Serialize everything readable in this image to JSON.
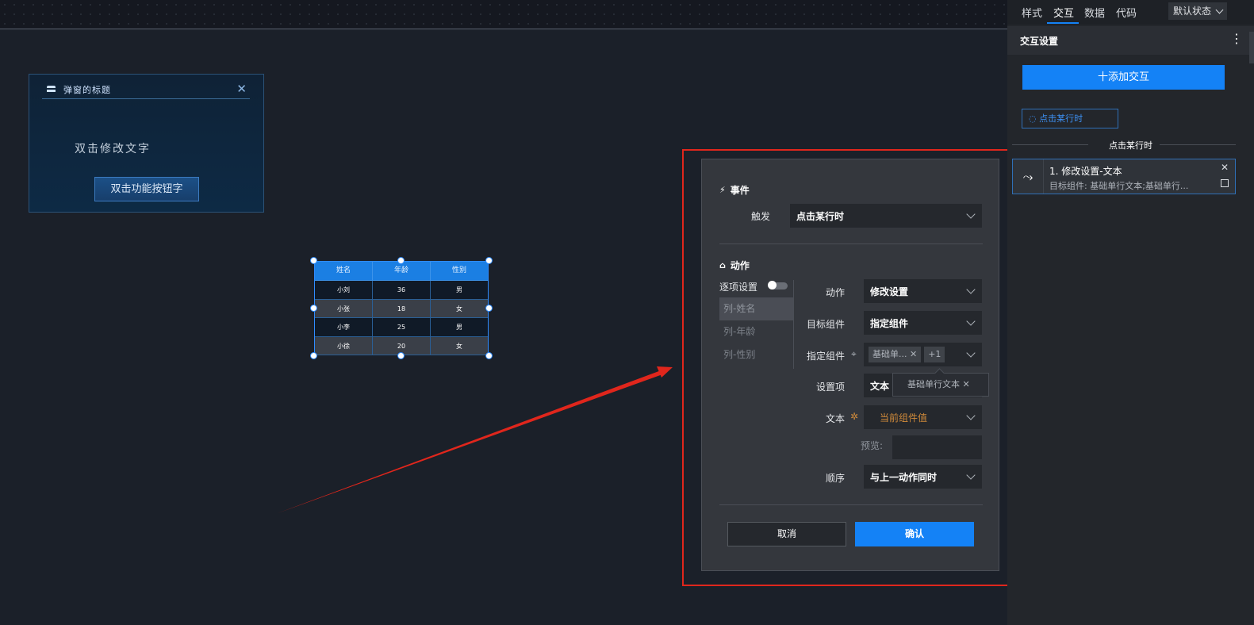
{
  "canvas": {
    "popup": {
      "title": "弹窗的标题",
      "text": "双击修改文字",
      "button": "双击功能按钮字"
    },
    "table": {
      "headers": [
        "姓名",
        "年龄",
        "性别"
      ],
      "rows": [
        [
          "小刘",
          "36",
          "男"
        ],
        [
          "小张",
          "18",
          "女"
        ],
        [
          "小李",
          "25",
          "男"
        ],
        [
          "小徐",
          "20",
          "女"
        ]
      ]
    }
  },
  "dialog": {
    "event_title": "事件",
    "trigger_label": "触发",
    "trigger_value": "点击某行时",
    "action_title": "动作",
    "itemize_label": "逐项设置",
    "side_items": [
      "列-姓名",
      "列-年龄",
      "列-性别"
    ],
    "action_label": "动作",
    "action_value": "修改设置",
    "target_label": "目标组件",
    "target_value": "指定组件",
    "specify_label": "指定组件",
    "specify_chip": "基础单...",
    "specify_more": "+1",
    "tooltip": "基础单行文本",
    "setting_label": "设置项",
    "setting_value": "文本",
    "text_label": "文本",
    "text_value": "当前组件值",
    "preview_label": "预览:",
    "order_label": "顺序",
    "order_value": "与上一动作同时",
    "cancel": "取消",
    "confirm": "确认"
  },
  "panel": {
    "tabs": [
      "样式",
      "交互",
      "数据",
      "代码"
    ],
    "state": "默认状态",
    "header": "交互设置",
    "add_button": "十添加交互",
    "trigger_tag": "点击某行时",
    "section_label": "点击某行时",
    "interaction_title": "1. 修改设置-文本",
    "interaction_desc": "目标组件: 基础单行文本;基础单行..."
  },
  "colors": {
    "accent": "#1482f6",
    "highlight": "#e0261c",
    "text_value": "#d08a3a"
  }
}
